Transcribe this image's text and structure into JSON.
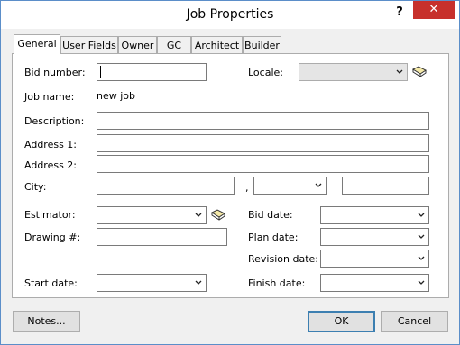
{
  "window": {
    "title": "Job Properties",
    "help_label": "?",
    "close_label": "✕"
  },
  "tabs": [
    {
      "label": "General",
      "active": true
    },
    {
      "label": "User Fields"
    },
    {
      "label": "Owner"
    },
    {
      "label": "GC"
    },
    {
      "label": "Architect"
    },
    {
      "label": "Builder"
    }
  ],
  "fields": {
    "bid_number": {
      "label": "Bid number:",
      "value": ""
    },
    "locale": {
      "label": "Locale:",
      "value": ""
    },
    "job_name": {
      "label": "Job name:",
      "value": "new job"
    },
    "description": {
      "label": "Description:",
      "value": ""
    },
    "address1": {
      "label": "Address 1:",
      "value": ""
    },
    "address2": {
      "label": "Address 2:",
      "value": ""
    },
    "city": {
      "label": "City:",
      "value": "",
      "separator": ","
    },
    "state": {
      "value": ""
    },
    "zip": {
      "value": ""
    },
    "estimator": {
      "label": "Estimator:",
      "value": ""
    },
    "drawing": {
      "label": "Drawing #:",
      "value": ""
    },
    "start_date": {
      "label": "Start date:",
      "value": ""
    },
    "bid_date": {
      "label": "Bid date:",
      "value": ""
    },
    "plan_date": {
      "label": "Plan date:",
      "value": ""
    },
    "revision_date": {
      "label": "Revision date:",
      "value": ""
    },
    "finish_date": {
      "label": "Finish date:",
      "value": ""
    }
  },
  "buttons": {
    "notes": "Notes...",
    "ok": "OK",
    "cancel": "Cancel"
  },
  "icons": {
    "book": "book-icon",
    "dropdown": "chevron-down-icon"
  }
}
